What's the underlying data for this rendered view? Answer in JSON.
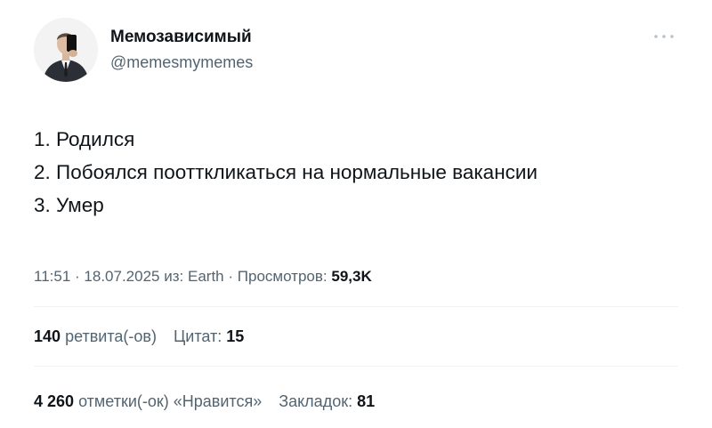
{
  "author": {
    "display_name": "Мемозависимый",
    "handle": "@memesmymemes"
  },
  "tweet": {
    "lines": [
      "1. Родился",
      "2. Побоялся поотткликаться на нормальные вакансии",
      "3. Умер"
    ]
  },
  "meta": {
    "time": "11:51",
    "separator": "·",
    "date": "18.07.2025",
    "source_prefix": "из:",
    "source": "Earth",
    "views_label": "Просмотров:",
    "views_count": "59,3K"
  },
  "stats": {
    "retweets_count": "140",
    "retweets_label": "ретвита(-ов)",
    "quotes_label": "Цитат:",
    "quotes_count": "15",
    "likes_count": "4 260",
    "likes_label": "отметки(-ок) «Нравится»",
    "bookmarks_label": "Закладок:",
    "bookmarks_count": "81"
  },
  "icons": {
    "avatar": "avatar-photo",
    "more": "more-horizontal-icon"
  },
  "colors": {
    "text_primary": "#0f1419",
    "text_secondary": "#536471",
    "divider": "#eff3f4"
  }
}
